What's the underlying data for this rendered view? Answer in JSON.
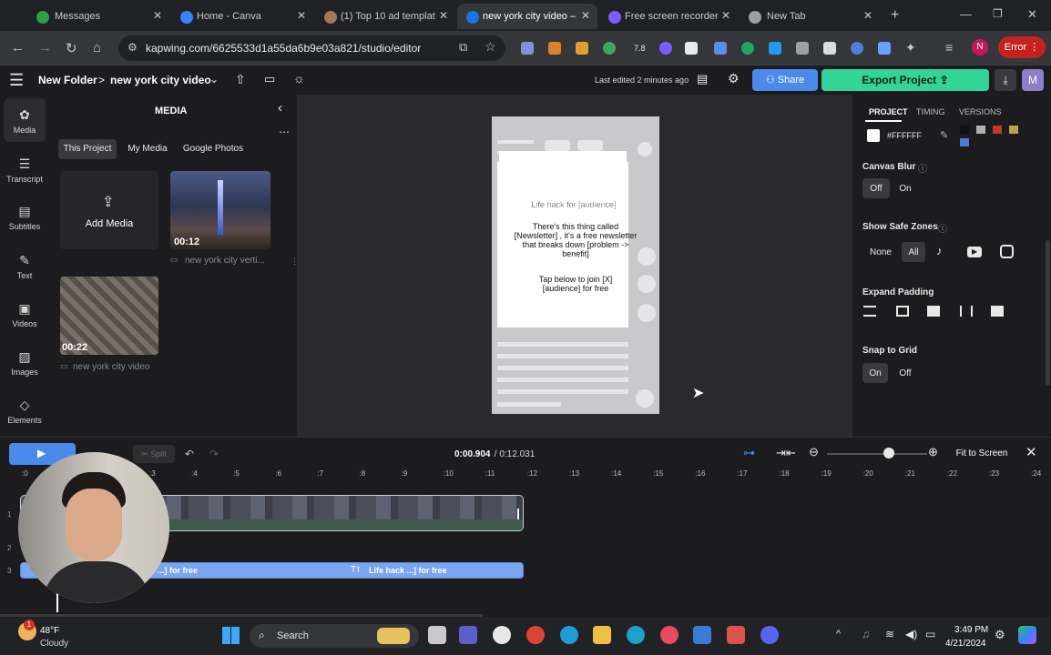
{
  "browser": {
    "tabs": [
      {
        "label": "Messages",
        "color": "#2f9e44"
      },
      {
        "label": "Home - Canva",
        "color": "#3b82f6"
      },
      {
        "label": "(1) Top 10 ad templat",
        "color": "#a0785a"
      },
      {
        "label": "new york city video –",
        "color": "#1a73e8"
      },
      {
        "label": "Free screen recorder",
        "color": "#7c5cff"
      },
      {
        "label": "New Tab",
        "color": "#9aa0a6"
      }
    ],
    "url": "kapwing.com/6625533d1a55da6b9e03a821/studio/editor",
    "ext_badge": "7.8",
    "profile_initial": "N",
    "error_label": "Error"
  },
  "header": {
    "breadcrumb_folder": "New Folder",
    "breadcrumb_sep": ">",
    "project_title": "new york city video",
    "last_edited": "Last edited 2 minutes ago",
    "share_label": "Share",
    "export_label": "Export Project",
    "avatar_initial": "M"
  },
  "rail": [
    {
      "label": "Media",
      "icon": "media-icon",
      "glyph": "✿"
    },
    {
      "label": "Transcript",
      "icon": "transcript-icon",
      "glyph": "☰"
    },
    {
      "label": "Subtitles",
      "icon": "subtitles-icon",
      "glyph": "▤"
    },
    {
      "label": "Text",
      "icon": "text-icon",
      "glyph": "✎"
    },
    {
      "label": "Videos",
      "icon": "videos-icon",
      "glyph": "▣"
    },
    {
      "label": "Images",
      "icon": "images-icon",
      "glyph": "▨"
    },
    {
      "label": "Elements",
      "icon": "elements-icon",
      "glyph": "◇"
    }
  ],
  "media": {
    "title": "MEDIA",
    "tabs": [
      "This Project",
      "My Media",
      "Google Photos"
    ],
    "add_label": "Add Media",
    "items": [
      {
        "duration": "00:12",
        "name": "new york city verti..."
      },
      {
        "duration": "00:22",
        "name": "new york city video"
      }
    ]
  },
  "canvas": {
    "text_lines": [
      "Life hack for [audience]",
      "There's this thing called [Newsletter] , it's a free newsletter that breaks down [problem -> benefit]",
      "Tap below to join [X] [audience] for free"
    ]
  },
  "right": {
    "tabs": [
      "PROJECT",
      "TIMING",
      "VERSIONS"
    ],
    "hex": "#FFFFFF",
    "swatches": [
      "#111111",
      "#b0b0b0",
      "#c0392b",
      "#b8a640",
      "#4a7bd6"
    ],
    "canvas_blur": {
      "label": "Canvas Blur",
      "off": "Off",
      "on": "On",
      "value": "Off"
    },
    "safe_zones": {
      "label": "Show Safe Zones",
      "none": "None",
      "all": "All",
      "value": "All"
    },
    "expand_padding": {
      "label": "Expand Padding"
    },
    "snap_grid": {
      "label": "Snap to Grid",
      "on": "On",
      "off": "Off",
      "value": "On"
    }
  },
  "timeline": {
    "split_label": "Split",
    "time_current": "0:00.904",
    "time_total": " / 0:12.031",
    "fit_label": "Fit to Screen",
    "zoom_level": 0.62,
    "ruler": [
      ":3",
      ":4",
      ":5",
      ":6",
      ":7",
      ":8",
      ":9",
      ":10",
      ":11",
      ":12",
      ":13",
      ":14",
      ":15",
      ":16",
      ":17",
      ":18",
      ":19",
      ":20",
      ":21",
      ":22",
      ":23",
      ":24"
    ],
    "ruler_start": ":0",
    "track_numbers": [
      "1",
      "2",
      "3"
    ],
    "caption_left": "...] for free",
    "caption_right": "Life hack ...] for free"
  },
  "taskbar": {
    "weather_temp": "48°F",
    "weather_desc": "Cloudy",
    "search_label": "Search",
    "time": "3:49 PM",
    "date": "4/21/2024",
    "notif_badge": "1"
  }
}
